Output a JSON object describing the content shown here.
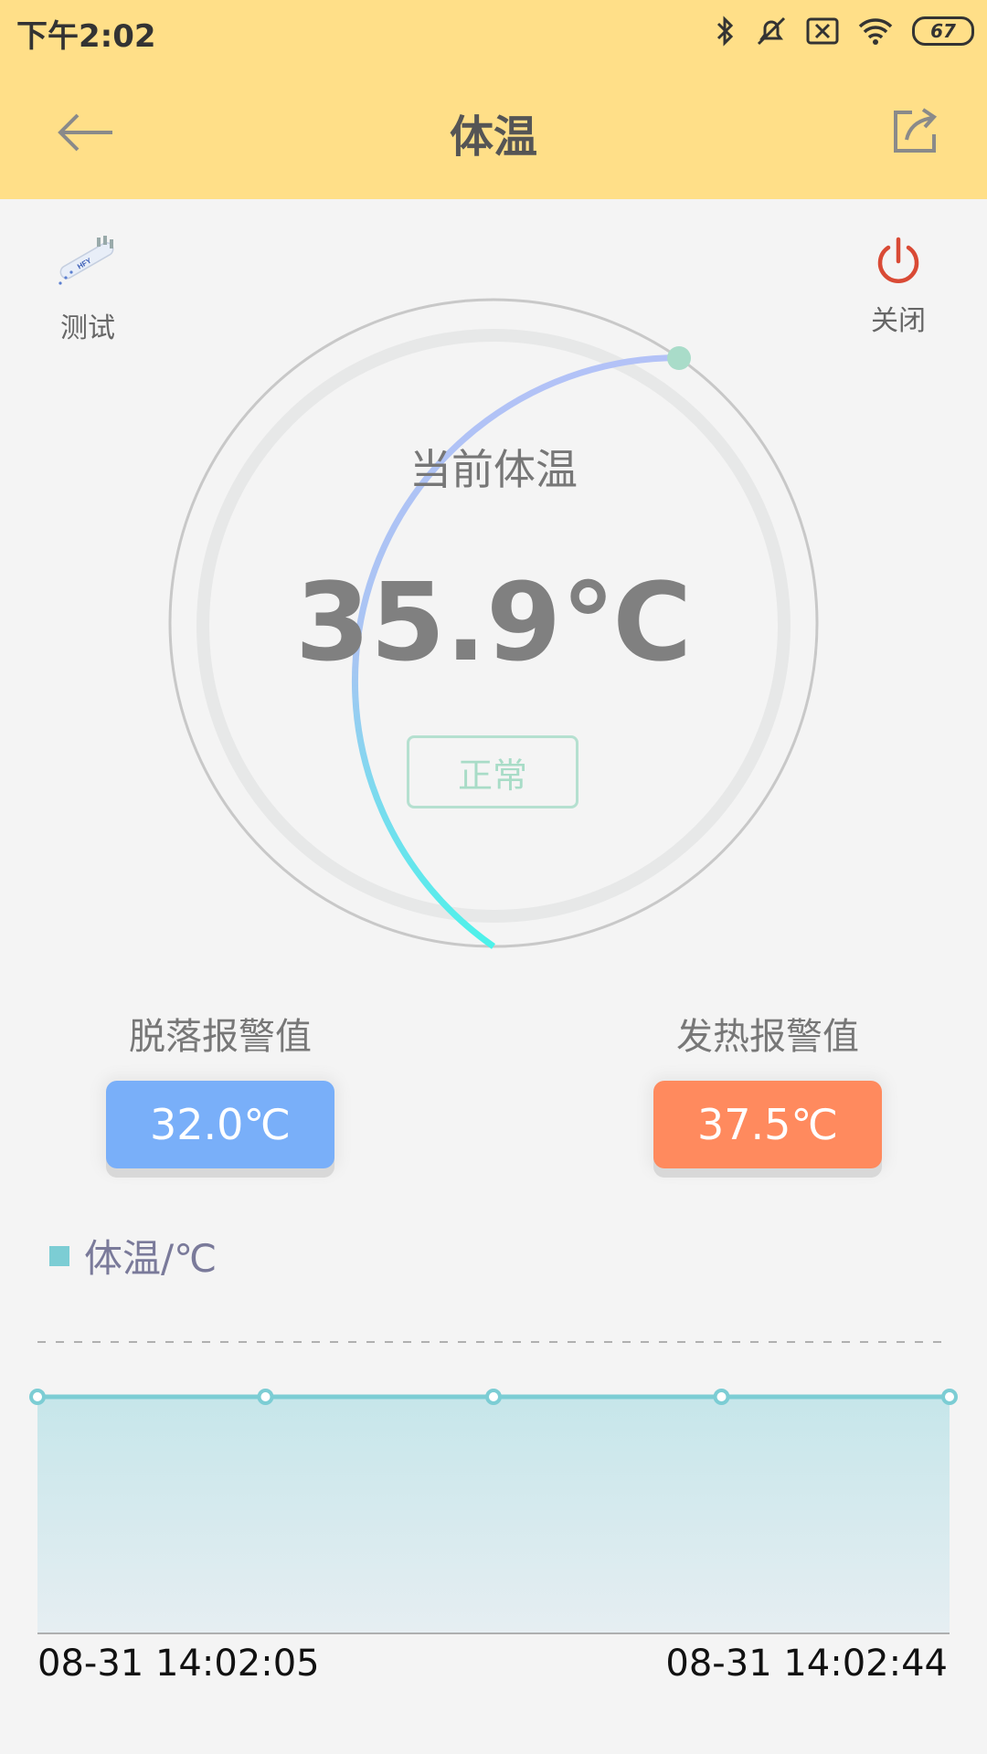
{
  "status_bar": {
    "time": "下午2:02",
    "battery": "67"
  },
  "header": {
    "title": "体温"
  },
  "tools": {
    "test_label": "测试",
    "close_label": "关闭"
  },
  "gauge": {
    "label": "当前体温",
    "value": "35.9℃",
    "status": "正常"
  },
  "alarms": {
    "detach": {
      "title": "脱落报警值",
      "value": "32.0℃",
      "color": "#79aff9"
    },
    "fever": {
      "title": "发热报警值",
      "value": "37.5℃",
      "color": "#ff8a5e"
    }
  },
  "chart_data": {
    "type": "area",
    "legend": "体温/℃",
    "x": [
      "08-31 14:02:05",
      "",
      "",
      "",
      "08-31 14:02:44"
    ],
    "series": [
      {
        "name": "体温/℃",
        "values": [
          35.9,
          35.9,
          35.9,
          35.9,
          35.9
        ]
      }
    ],
    "x_tick_labels": [
      "08-31 14:02:05",
      "08-31 14:02:44"
    ],
    "grid": true,
    "color": "#7ccdd4"
  }
}
